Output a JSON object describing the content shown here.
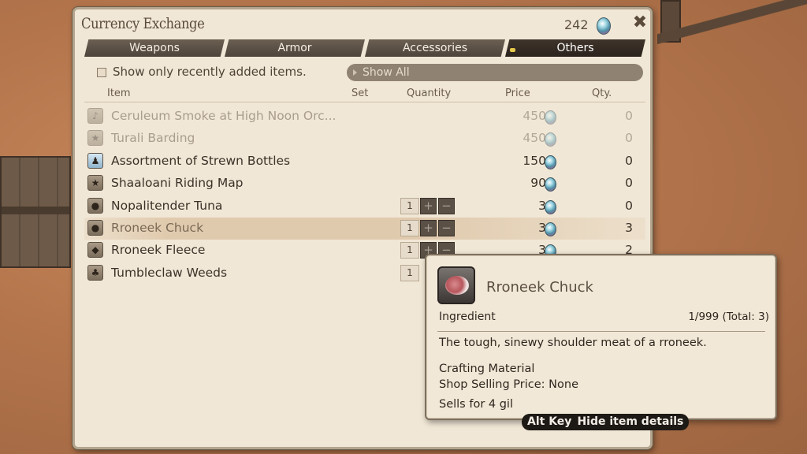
{
  "window": {
    "title": "Currency Exchange",
    "currency_amount": "242",
    "currency_icon": "allagan-tomestone-gem-icon",
    "close_icon": "close-crossed-icon"
  },
  "tabs": [
    {
      "label": "Weapons",
      "active": false
    },
    {
      "label": "Armor",
      "active": false
    },
    {
      "label": "Accessories",
      "active": false
    },
    {
      "label": "Others",
      "active": true
    }
  ],
  "filters": {
    "show_recent_label": "Show only recently added items.",
    "show_recent_checked": false,
    "show_all_label": "Show All"
  },
  "columns": {
    "item": "Item",
    "set": "Set",
    "quantity": "Quantity",
    "price": "Price",
    "qty": "Qty."
  },
  "items": [
    {
      "name": "Ceruleum Smoke at High Noon Orc...",
      "price": "450",
      "qty": "0",
      "available": false,
      "has_stepper": false,
      "icon": "music-note-icon"
    },
    {
      "name": "Turali Barding",
      "price": "450",
      "qty": "0",
      "available": false,
      "has_stepper": false,
      "icon": "barding-star-icon"
    },
    {
      "name": "Assortment of Strewn Bottles",
      "price": "150",
      "qty": "0",
      "available": true,
      "has_stepper": false,
      "icon": "bottles-icon"
    },
    {
      "name": "Shaaloani Riding Map",
      "price": "90",
      "qty": "0",
      "available": true,
      "has_stepper": false,
      "icon": "map-star-icon"
    },
    {
      "name": "Nopalitender Tuna",
      "price": "3",
      "qty": "0",
      "available": true,
      "has_stepper": true,
      "stepper_value": "1",
      "icon": "tuna-icon"
    },
    {
      "name": "Rroneek Chuck",
      "price": "3",
      "qty": "3",
      "available": true,
      "has_stepper": true,
      "stepper_value": "1",
      "selected": true,
      "icon": "meat-icon"
    },
    {
      "name": "Rroneek Fleece",
      "price": "3",
      "qty": "2",
      "available": true,
      "has_stepper": true,
      "stepper_value": "1",
      "icon": "fleece-icon"
    },
    {
      "name": "Tumbleclaw Weeds",
      "price": "",
      "qty": "",
      "available": true,
      "has_stepper": true,
      "stepper_value": "1",
      "icon": "weeds-icon"
    }
  ],
  "stepper": {
    "plus": "+",
    "minus": "−"
  },
  "tooltip": {
    "name": "Rroneek Chuck",
    "category": "Ingredient",
    "count": "1/999 (Total: 3)",
    "description": "The tough, sinewy shoulder meat of a rroneek.",
    "crafting": "Crafting Material",
    "shop_price": "Shop Selling Price: None",
    "sells": "Sells for 4 gil"
  },
  "hint": {
    "key": "Alt Key",
    "label": "Hide item details"
  }
}
